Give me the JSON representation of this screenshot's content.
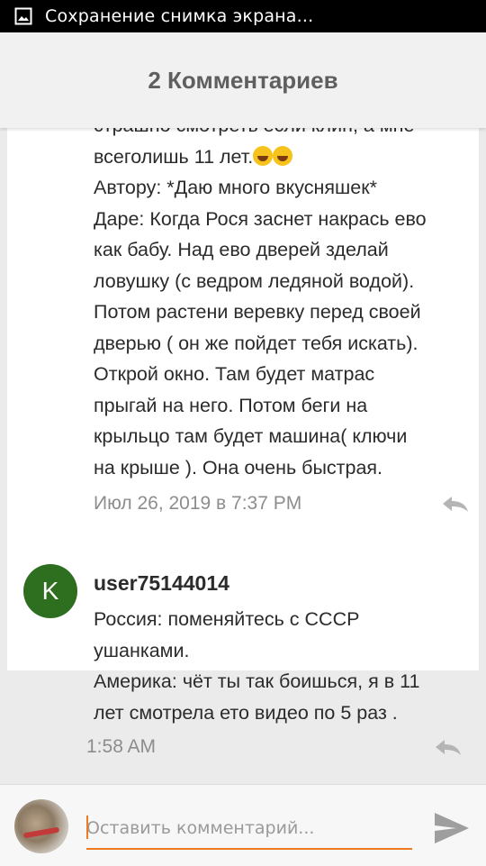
{
  "status_bar": {
    "notification_text": "Сохранение снимка экрана...",
    "icon": "screenshot-icon"
  },
  "header": {
    "title": "2 Комментариев"
  },
  "comments": [
    {
      "lines": [
        "страшно смотреть если клин, а мне",
        "всеголишь 11 лет.",
        "Автору: *Даю много вкусняшек*",
        "Даре: Когда Рося заснет накрась ево",
        "как бабу. Над ево дверей зделай",
        "ловушку (с ведром ледяной водой).",
        "Потом растени веревку перед своей",
        "дверью ( он же пойдет тебя искать).",
        "Открой окно. Там будет матрас",
        "прыгай на него. Потом беги на",
        "крыльцо там будет машина( ключи",
        "на крыше ). Она очень быстрая."
      ],
      "emoji": "laughing-emoji",
      "timestamp": "Июл 26, 2019 в 7:37 PM",
      "reply_icon": "reply-icon"
    },
    {
      "avatar_letter": "K",
      "avatar_color": "#2e6e1f",
      "username": "user75144014",
      "lines": [
        "Россия:  поменяйтесь с СССР",
        "ушанками.",
        "Америка: чёт ты так боишься,  я в 11",
        "лет смотрела ето видео по 5 раз ."
      ],
      "timestamp": "1:58 AM",
      "reply_icon": "reply-icon"
    }
  ],
  "compose": {
    "placeholder": "Оставить комментарий...",
    "value": "",
    "accent_color": "#f07a24",
    "send_icon": "send-icon"
  }
}
